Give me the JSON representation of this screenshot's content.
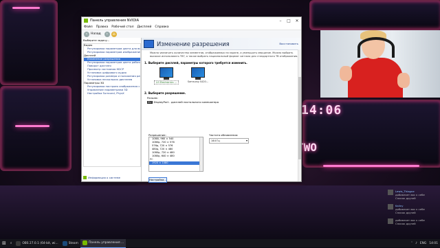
{
  "window": {
    "title": "Панель управления NVIDIA",
    "menu": [
      "Файл",
      "Правка",
      "Рабочий стол",
      "Дисплей",
      "Справка"
    ],
    "toolbar": {
      "back": "Назад",
      "forward": ""
    }
  },
  "left_panel": {
    "header": "Выберите задачу...",
    "tree": [
      {
        "label": "Видео",
        "type": "cat"
      },
      {
        "label": "Регулировка параметров цвета для видео",
        "type": "item"
      },
      {
        "label": "Регулировка параметров изображения д...",
        "type": "item"
      },
      {
        "label": "Дисплей",
        "type": "cat"
      },
      {
        "label": "Изменение разрешения",
        "type": "sel"
      },
      {
        "label": "Регулировка параметров цвета рабочего ст...",
        "type": "item"
      },
      {
        "label": "Поворот дисплея",
        "type": "item"
      },
      {
        "label": "Просмотр состояния HDCP",
        "type": "item"
      },
      {
        "label": "Установка цифрового аудио",
        "type": "item"
      },
      {
        "label": "Регулировка размера и положения рабочег...",
        "type": "item"
      },
      {
        "label": "Установка нескольких дисплеев",
        "type": "item"
      },
      {
        "label": "Параметры 3D",
        "type": "cat"
      },
      {
        "label": "Регулировка настроек изображения с про...",
        "type": "item"
      },
      {
        "label": "Управление параметрами 3D",
        "type": "item"
      },
      {
        "label": "Настройка Surround, PhysX",
        "type": "item"
      }
    ],
    "system_info": "Информация о системе"
  },
  "right_panel": {
    "title": "Изменение разрешения",
    "restore": "Восстановить",
    "description": "Можно увеличить количество элементов, отображаемых на экране, и уменьшить мерцание. Можно выбрать высокое использовать ТВ?, а также выбрать национальный формат сигнала для стандартного ТВ отображения.",
    "step1": "1. Выберите дисплей, параметры которого требуется изменить.",
    "monitors": [
      {
        "label": "LG Electronics ..."
      },
      {
        "label": "Samsung S420..."
      }
    ],
    "step2": "2. Выберите разрешение.",
    "connection_label": "Разъем:",
    "connection_chip": "DVI",
    "connection_value": "DisplayPort - дисплей настольного компьютера",
    "resolution_label": "Разрешение:",
    "refresh_label": "Частота обновления:",
    "refresh_value": "144 Гц",
    "resolutions": [
      {
        "label": "1080i, 960 × 540",
        "type": "item"
      },
      {
        "label": "1080p, 720 × 576",
        "type": "item"
      },
      {
        "label": "576p, 720 × 576",
        "type": "item"
      },
      {
        "label": "480p, 720 × 480",
        "type": "item"
      },
      {
        "label": "1080p, 720 × 480",
        "type": "item"
      },
      {
        "label": "1080p, 640 × 480",
        "type": "item"
      },
      {
        "label": "PC",
        "type": "hdr"
      },
      {
        "label": "1920 × 1080",
        "type": "sel"
      }
    ],
    "settings_button": "Настройка..."
  },
  "desktop": {
    "clock_big": "14:06",
    "clock_text": "TWO"
  },
  "notifications": [
    {
      "name": "Lewis_Thiagne",
      "action": "добавляет вас к себе",
      "extra": "Список друзей"
    },
    {
      "name": "Kaliny",
      "action": "добавляет вас к себе",
      "extra": "Список друзей"
    },
    {
      "name": "n/a",
      "action": "добавляет вас к себе",
      "extra": "Список друзей"
    }
  ],
  "taskbar": {
    "items": [
      {
        "label": "OBS 27.0.1 (64-bit, wi...",
        "color": "#3a3a3a"
      },
      {
        "label": "Steam",
        "color": "#1b4a7a"
      },
      {
        "label": "Панель управления ...",
        "color": "#76b900"
      }
    ],
    "tray": {
      "lang": "ENG",
      "time": "14:01"
    }
  }
}
